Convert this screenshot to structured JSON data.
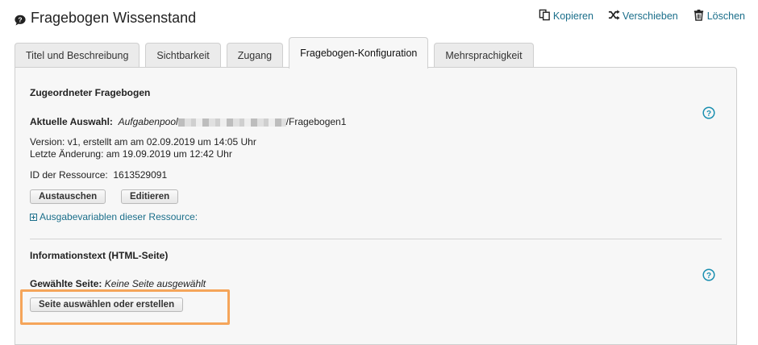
{
  "page": {
    "title": "Fragebogen Wissenstand",
    "title_icon": "speech-bubble-question-icon"
  },
  "actions": [
    {
      "label": "Kopieren",
      "icon": "copy-icon"
    },
    {
      "label": "Verschieben",
      "icon": "shuffle-icon"
    },
    {
      "label": "Löschen",
      "icon": "trash-icon"
    }
  ],
  "tabs": [
    {
      "label": "Titel und Beschreibung",
      "active": false
    },
    {
      "label": "Sichtbarkeit",
      "active": false
    },
    {
      "label": "Zugang",
      "active": false
    },
    {
      "label": "Fragebogen-Konfiguration",
      "active": true
    },
    {
      "label": "Mehrsprachigkeit",
      "active": false
    }
  ],
  "section1": {
    "title": "Zugeordneter Fragebogen",
    "selection_label": "Aktuelle Auswahl:",
    "selection_prefix": "Aufgabenpool",
    "selection_suffix": "/Fragebogen1",
    "version_line": "Version:  v1, erstellt am am 02.09.2019 um 14:05 Uhr",
    "changed_line": "Letzte Änderung: am 19.09.2019 um 12:42 Uhr",
    "resource_id_label": "ID der Ressource:",
    "resource_id_value": "1613529091",
    "btn_replace": "Austauschen",
    "btn_edit": "Editieren",
    "output_vars_link": "Ausgabevariablen dieser Ressource:"
  },
  "section2": {
    "title": "Informationstext (HTML-Seite)",
    "selected_page_label": "Gewählte Seite:",
    "selected_page_value": "Keine Seite ausgewählt",
    "btn_select": "Seite auswählen oder erstellen"
  },
  "colors": {
    "link": "#1a6e8a",
    "highlight": "#f5a55a",
    "panel_bg": "#f7f7f7"
  }
}
